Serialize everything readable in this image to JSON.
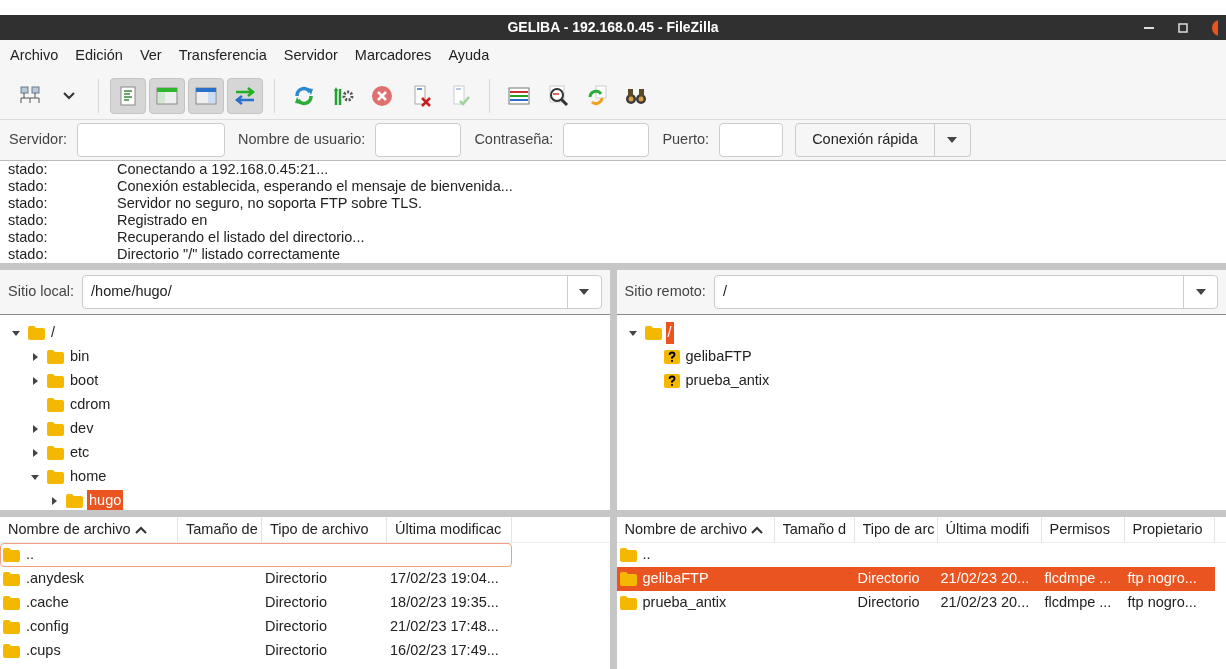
{
  "window": {
    "title": "GELIBA - 192.168.0.45 - FileZilla"
  },
  "menu": [
    "Archivo",
    "Edición",
    "Ver",
    "Transferencia",
    "Servidor",
    "Marcadores",
    "Ayuda"
  ],
  "toolbar": [
    {
      "kind": "site-manager"
    },
    {
      "kind": "dropdown"
    },
    {
      "kind": "separator"
    },
    {
      "kind": "log",
      "pressed": true
    },
    {
      "kind": "local-tree",
      "pressed": true
    },
    {
      "kind": "remote-tree",
      "pressed": true
    },
    {
      "kind": "queue",
      "pressed": true
    },
    {
      "kind": "separator"
    },
    {
      "kind": "refresh"
    },
    {
      "kind": "process"
    },
    {
      "kind": "cancel"
    },
    {
      "kind": "disconnect"
    },
    {
      "kind": "reconnect"
    },
    {
      "kind": "separator"
    },
    {
      "kind": "filter"
    },
    {
      "kind": "compare"
    },
    {
      "kind": "sync"
    },
    {
      "kind": "find"
    }
  ],
  "quickconnect": {
    "fields": [
      {
        "label": "Servidor:"
      },
      {
        "label": "Nombre de usuario:"
      },
      {
        "label": "Contraseña:"
      },
      {
        "label": "Puerto:"
      }
    ],
    "button": "Conexión rápida"
  },
  "log": [
    {
      "type": "stado:",
      "message": "Conectando a 192.168.0.45:21..."
    },
    {
      "type": "stado:",
      "message": "Conexión establecida, esperando el mensaje de bienvenida..."
    },
    {
      "type": "stado:",
      "message": "Servidor no seguro, no soporta FTP sobre TLS."
    },
    {
      "type": "stado:",
      "message": "Registrado en"
    },
    {
      "type": "stado:",
      "message": "Recuperando el listado del directorio..."
    },
    {
      "type": "stado:",
      "message": "Directorio \"/\" listado correctamente"
    }
  ],
  "local": {
    "site_label": "Sitio local:",
    "path": "/home/hugo/",
    "tree": [
      {
        "label": "/",
        "kind": "folder",
        "expandable": true,
        "expanded": true,
        "selected": false,
        "children": [
          {
            "label": "bin",
            "kind": "folder",
            "expandable": true,
            "expanded": false,
            "selected": false
          },
          {
            "label": "boot",
            "kind": "folder",
            "expandable": true,
            "expanded": false,
            "selected": false
          },
          {
            "label": "cdrom",
            "kind": "folder",
            "expandable": false,
            "expanded": false,
            "selected": false
          },
          {
            "label": "dev",
            "kind": "folder",
            "expandable": true,
            "expanded": false,
            "selected": false
          },
          {
            "label": "etc",
            "kind": "folder",
            "expandable": true,
            "expanded": false,
            "selected": false
          },
          {
            "label": "home",
            "kind": "folder",
            "expandable": true,
            "expanded": true,
            "selected": false,
            "children": [
              {
                "label": "hugo",
                "kind": "folder",
                "expandable": true,
                "expanded": false,
                "selected": true
              }
            ]
          }
        ]
      }
    ],
    "columns": [
      {
        "label": "Nombre de archivo",
        "sorted": true
      },
      {
        "label": "Tamaño de",
        "sorted": false
      },
      {
        "label": "Tipo de archivo",
        "sorted": false
      },
      {
        "label": "Última modificac",
        "sorted": false
      }
    ],
    "rows": [
      {
        "cells": [
          "..",
          "",
          "",
          ""
        ],
        "selected": false,
        "focused": true
      },
      {
        "cells": [
          ".anydesk",
          "",
          "Directorio",
          "17/02/23 19:04..."
        ],
        "selected": false,
        "focused": false
      },
      {
        "cells": [
          ".cache",
          "",
          "Directorio",
          "18/02/23 19:35..."
        ],
        "selected": false,
        "focused": false
      },
      {
        "cells": [
          ".config",
          "",
          "Directorio",
          "21/02/23 17:48..."
        ],
        "selected": false,
        "focused": false
      },
      {
        "cells": [
          ".cups",
          "",
          "Directorio",
          "16/02/23 17:49..."
        ],
        "selected": false,
        "focused": false
      }
    ]
  },
  "remote": {
    "site_label": "Sitio remoto:",
    "path": "/",
    "tree": [
      {
        "label": "/",
        "kind": "folder",
        "expandable": true,
        "expanded": true,
        "selected": true,
        "children": [
          {
            "label": "gelibaFTP",
            "kind": "unknown",
            "expandable": false,
            "expanded": false,
            "selected": false
          },
          {
            "label": "prueba_antix",
            "kind": "unknown",
            "expandable": false,
            "expanded": false,
            "selected": false
          }
        ]
      }
    ],
    "columns": [
      {
        "label": "Nombre de archivo",
        "sorted": true
      },
      {
        "label": "Tamaño d",
        "sorted": false
      },
      {
        "label": "Tipo de arc",
        "sorted": false
      },
      {
        "label": "Última modifi",
        "sorted": false
      },
      {
        "label": "Permisos",
        "sorted": false
      },
      {
        "label": "Propietario",
        "sorted": false
      }
    ],
    "rows": [
      {
        "cells": [
          "..",
          "",
          "",
          "",
          "",
          ""
        ],
        "selected": false,
        "focused": false
      },
      {
        "cells": [
          "gelibaFTP",
          "",
          "Directorio",
          "21/02/23 20...",
          "flcdmpe ...",
          "ftp nogro..."
        ],
        "selected": true,
        "focused": false
      },
      {
        "cells": [
          "prueba_antix",
          "",
          "Directorio",
          "21/02/23 20...",
          "flcdmpe ...",
          "ftp nogro..."
        ],
        "selected": false,
        "focused": false
      }
    ]
  }
}
